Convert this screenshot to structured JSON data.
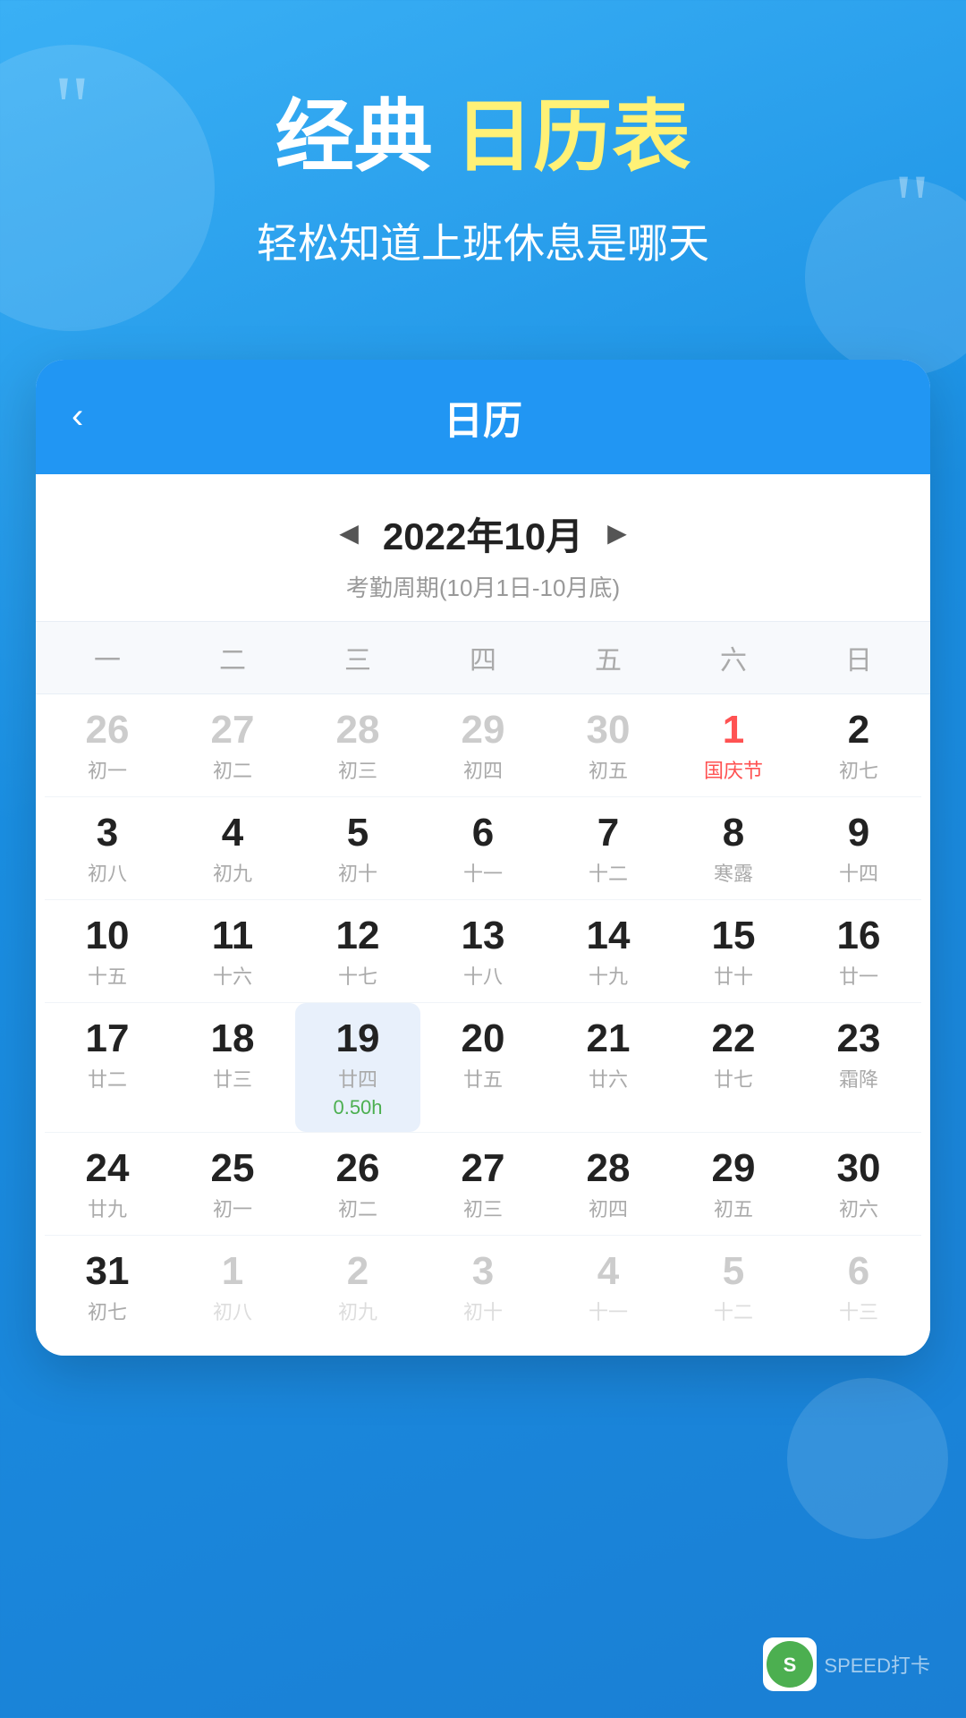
{
  "header": {
    "quote_left": "“",
    "quote_right": "”",
    "title_part1": "经典",
    "title_part2": "日历表",
    "subtitle": "轻松知道上班休息是哪天"
  },
  "calendar": {
    "back_icon": "‹",
    "title": "日历",
    "month_prev": "◄",
    "month_next": "►",
    "month_title": "2022年10月",
    "attendance_period": "考勤周期(10月1日-10月底)",
    "weekdays": [
      "一",
      "二",
      "三",
      "四",
      "五",
      "六",
      "日"
    ],
    "weeks": [
      [
        {
          "day": "26",
          "lunar": "初一",
          "dim": true
        },
        {
          "day": "27",
          "lunar": "初二",
          "dim": true
        },
        {
          "day": "28",
          "lunar": "初三",
          "dim": true
        },
        {
          "day": "29",
          "lunar": "初四",
          "dim": true
        },
        {
          "day": "30",
          "lunar": "初五",
          "dim": true
        },
        {
          "day": "1",
          "lunar": "国庆节",
          "red": true
        },
        {
          "day": "2",
          "lunar": "初七"
        }
      ],
      [
        {
          "day": "3",
          "lunar": "初八"
        },
        {
          "day": "4",
          "lunar": "初九"
        },
        {
          "day": "5",
          "lunar": "初十"
        },
        {
          "day": "6",
          "lunar": "十一"
        },
        {
          "day": "7",
          "lunar": "十二"
        },
        {
          "day": "8",
          "lunar": "寒露"
        },
        {
          "day": "9",
          "lunar": "十四"
        }
      ],
      [
        {
          "day": "10",
          "lunar": "十五"
        },
        {
          "day": "11",
          "lunar": "十六"
        },
        {
          "day": "12",
          "lunar": "十七"
        },
        {
          "day": "13",
          "lunar": "十八"
        },
        {
          "day": "14",
          "lunar": "十九"
        },
        {
          "day": "15",
          "lunar": "廿十"
        },
        {
          "day": "16",
          "lunar": "廿一"
        }
      ],
      [
        {
          "day": "17",
          "lunar": "廿二"
        },
        {
          "day": "18",
          "lunar": "廿三"
        },
        {
          "day": "19",
          "lunar": "廿四",
          "today": true,
          "note": "0.50h"
        },
        {
          "day": "20",
          "lunar": "廿五"
        },
        {
          "day": "21",
          "lunar": "廿六"
        },
        {
          "day": "22",
          "lunar": "廿七"
        },
        {
          "day": "23",
          "lunar": "霜降"
        }
      ],
      [
        {
          "day": "24",
          "lunar": "廿九"
        },
        {
          "day": "25",
          "lunar": "初一"
        },
        {
          "day": "26",
          "lunar": "初二"
        },
        {
          "day": "27",
          "lunar": "初三"
        },
        {
          "day": "28",
          "lunar": "初四"
        },
        {
          "day": "29",
          "lunar": "初五"
        },
        {
          "day": "30",
          "lunar": "初六"
        }
      ],
      [
        {
          "day": "31",
          "lunar": "初七"
        },
        {
          "day": "1",
          "lunar": "初八",
          "dim": true
        },
        {
          "day": "2",
          "lunar": "初九",
          "dim": true
        },
        {
          "day": "3",
          "lunar": "初十",
          "dim": true
        },
        {
          "day": "4",
          "lunar": "十一",
          "dim": true
        },
        {
          "day": "5",
          "lunar": "十二",
          "dim": true
        },
        {
          "day": "6",
          "lunar": "十三",
          "dim": true
        }
      ]
    ]
  },
  "watermark": {
    "text": "SPEED打卡"
  }
}
